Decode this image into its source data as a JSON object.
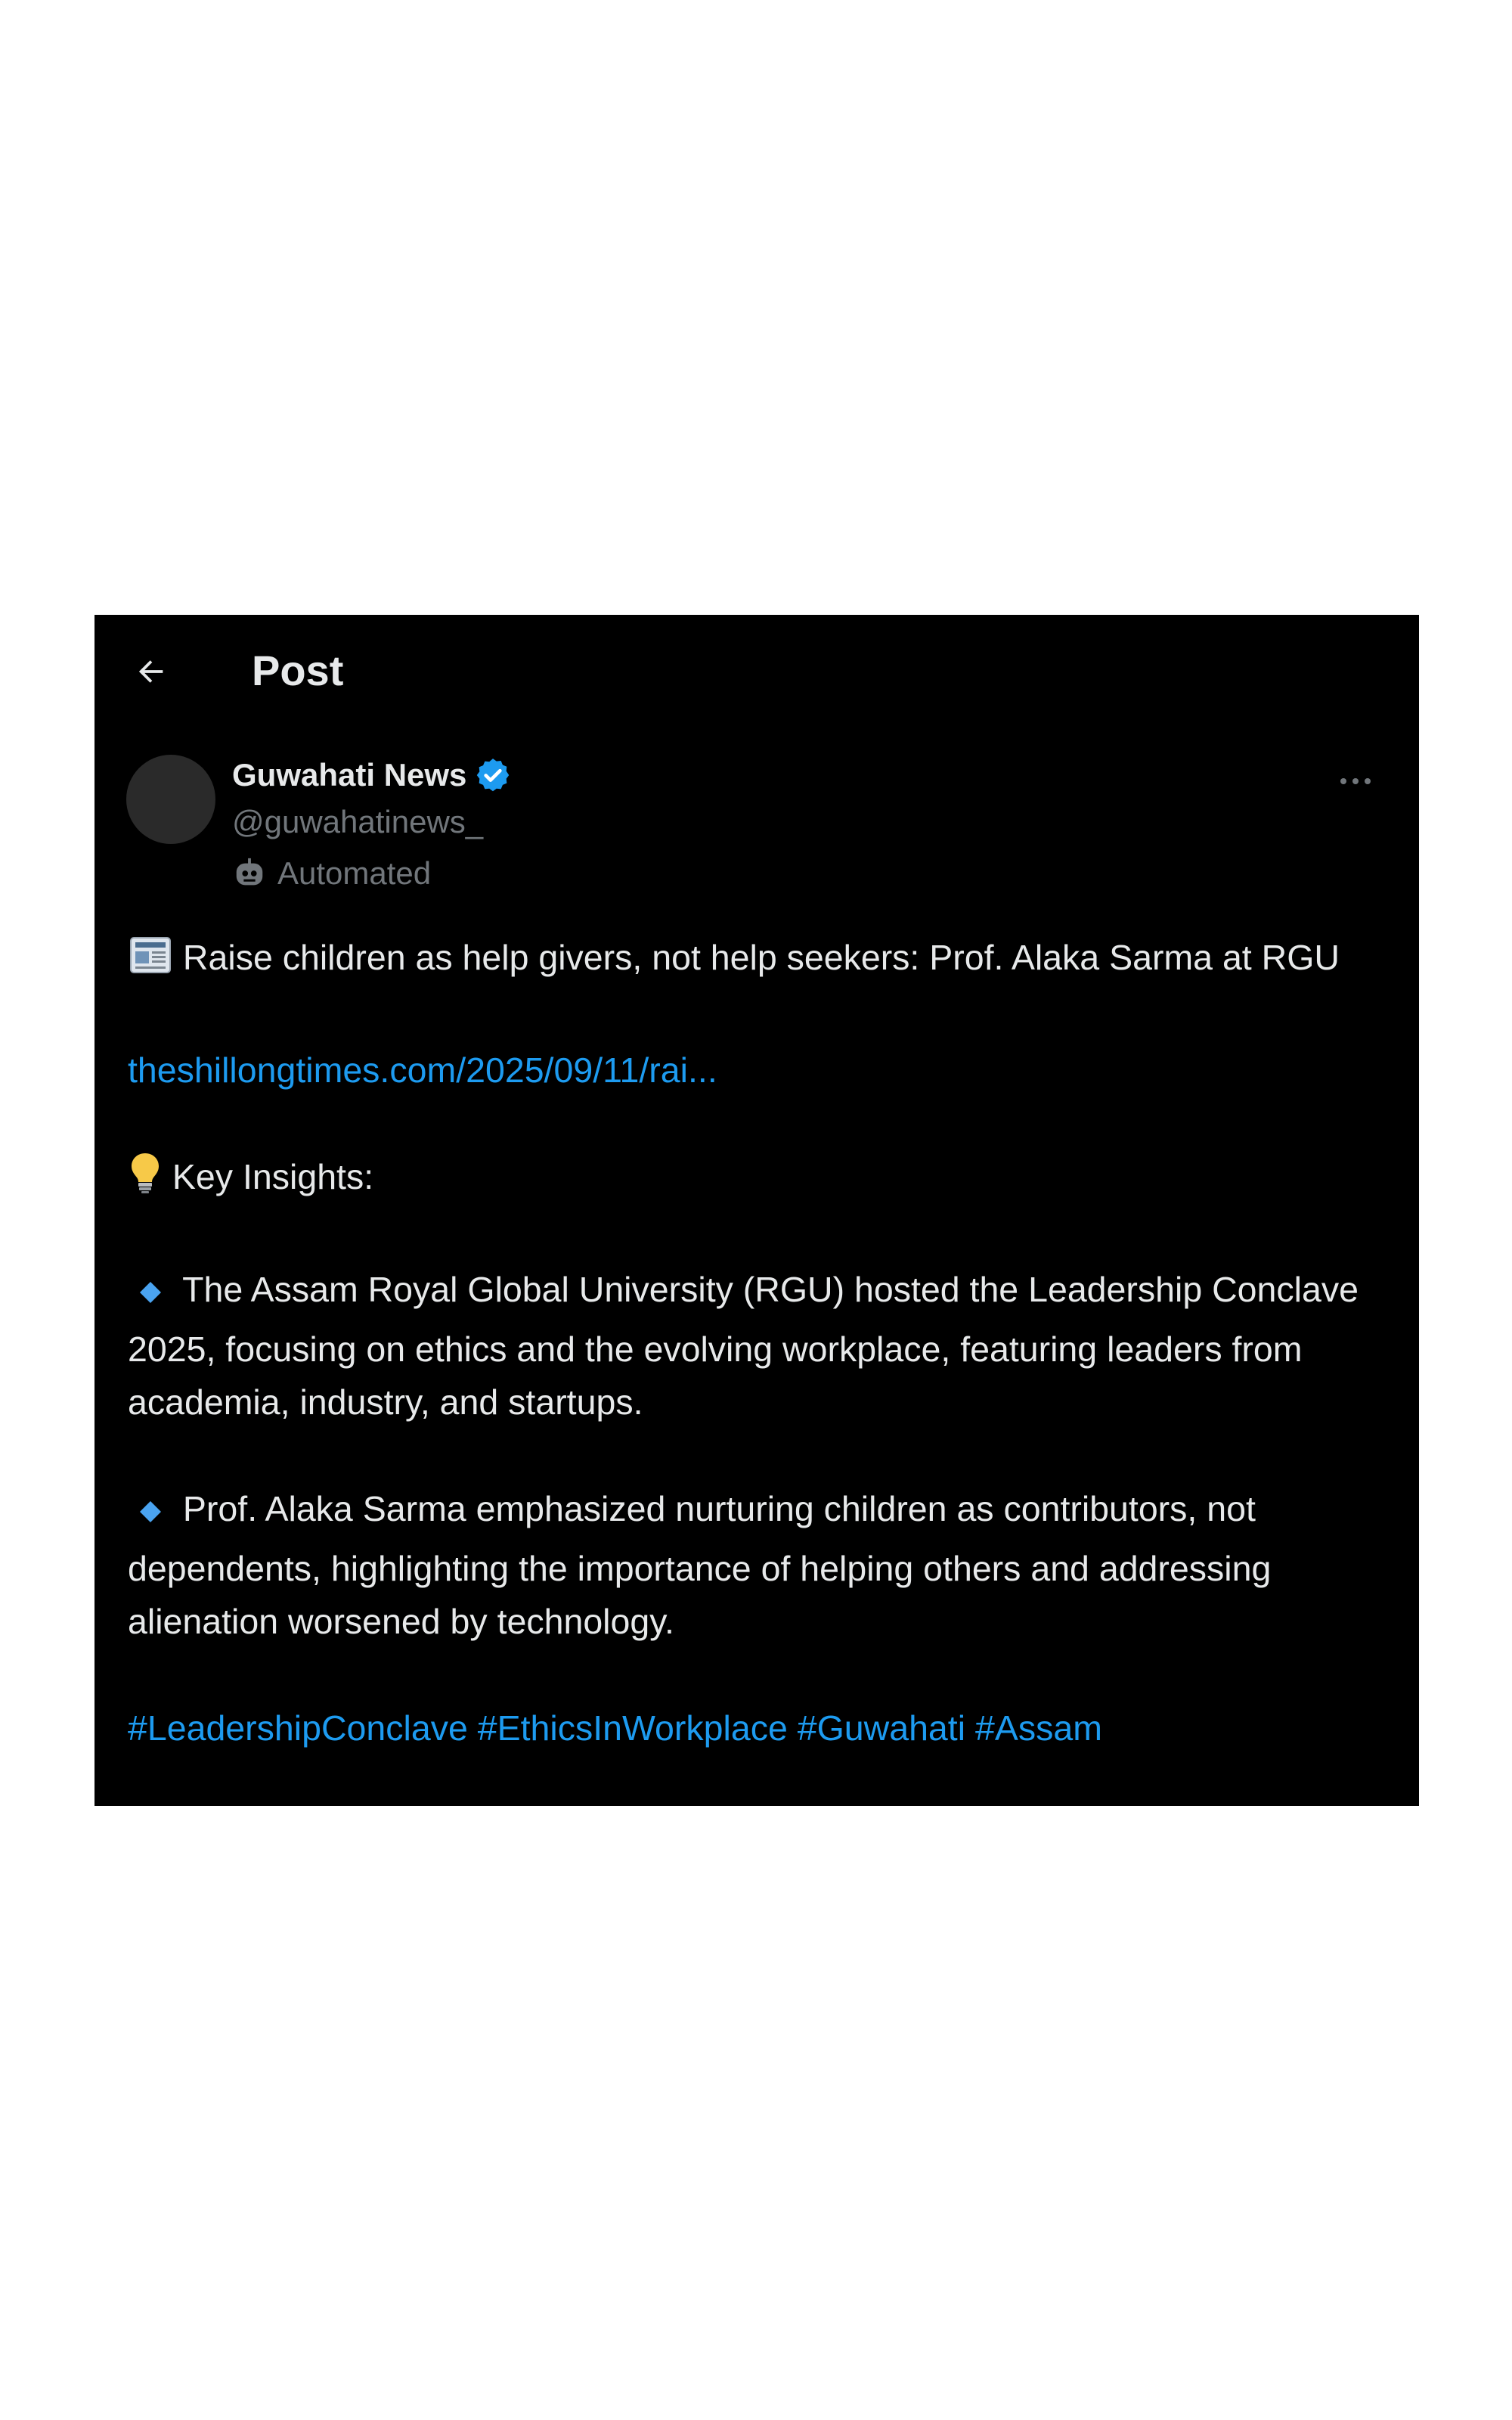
{
  "header": {
    "title": "Post"
  },
  "post": {
    "author": {
      "display_name": "Guwahati News",
      "handle": "@guwahatinews_",
      "automated_label": "Automated",
      "verified": true
    },
    "headline": "Raise children as help givers, not help seekers: Prof. Alaka Sarma at RGU",
    "link_text": "theshillongtimes.com/2025/09/11/rai...",
    "insights_heading": "Key Insights:",
    "bullets": [
      "The Assam Royal Global University (RGU) hosted the Leadership Conclave 2025, focusing on ethics and the evolving workplace, featuring leaders from academia, industry, and startups.",
      "Prof. Alaka Sarma emphasized nurturing children as contributors, not dependents, highlighting the importance of helping others and addressing alienation worsened by technology."
    ],
    "hashtags": [
      "#LeadershipConclave",
      "#EthicsInWorkplace",
      "#Guwahati",
      "#Assam"
    ]
  },
  "icons": {
    "back": "arrow-left-icon",
    "verified": "verified-badge-icon",
    "automated": "bot-icon",
    "more": "more-horizontal-icon",
    "headline": "newspaper-icon",
    "insights": "lightbulb-icon",
    "bullet": "blue-diamond-icon"
  },
  "colors": {
    "background": "#000000",
    "text": "#e7e9ea",
    "muted": "#71767b",
    "link": "#1d9bf0"
  }
}
